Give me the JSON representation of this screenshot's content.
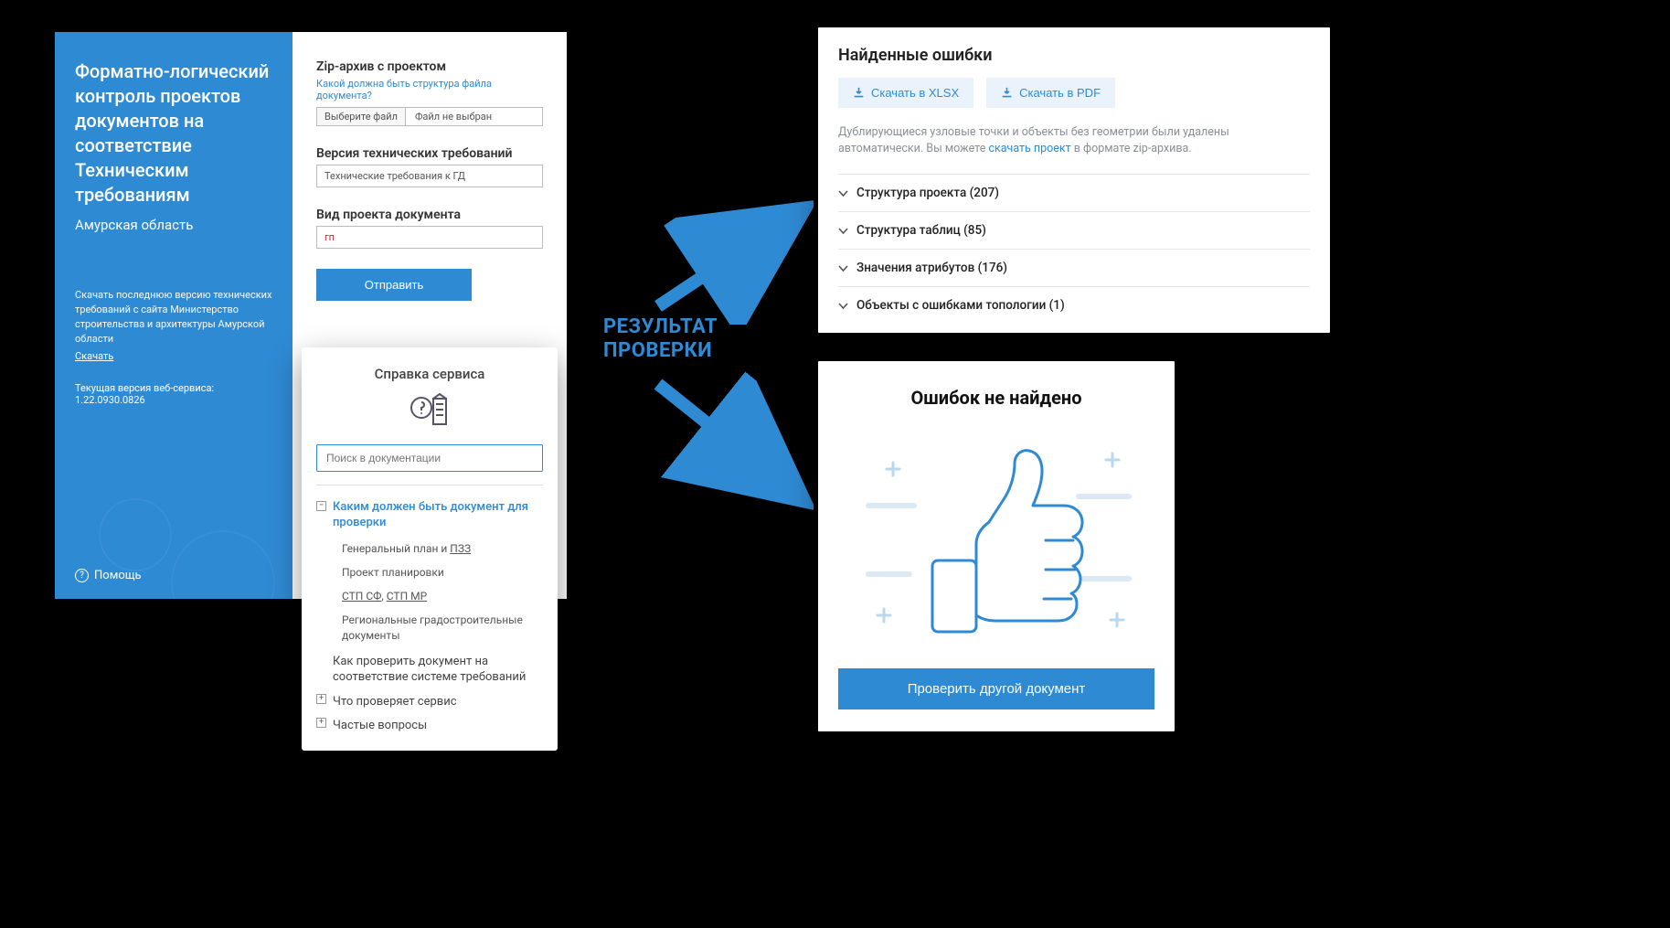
{
  "leftCard": {
    "title": "Форматно-логический контроль проектов документов на соответствие Техническим требованиям",
    "subtitle": "Амурская область",
    "desc": "Скачать последнюю версию технических требований с сайта Министерство строительства и архитектуры Амурской области",
    "downloadLink": "Скачать",
    "versionLabel": "Текущая версия веб-сервиса:",
    "version": "1.22.0930.0826",
    "helpLabel": "Помощь"
  },
  "form": {
    "zipLabel": "Zip-архив с проектом",
    "zipHint": "Какой должна быть структура файла документа?",
    "chooseFile": "Выберите файл",
    "noFile": "Файл не выбран",
    "versionLabel": "Версия технических требований",
    "versionValue": "Технические требования к ГД",
    "typeLabel": "Вид проекта документа",
    "typeValue": "гп",
    "submit": "Отправить"
  },
  "helpPanel": {
    "title": "Справка сервиса",
    "searchPlaceholder": "Поиск в документации",
    "section1": "Каким должен быть документ для проверки",
    "items": [
      "Генеральный план и ПЗЗ",
      "Проект планировки",
      "СТП СФ, СТП МР",
      "Региональные градостроительные документы"
    ],
    "item_gp_pzz_a": "Генеральный план и ",
    "item_gp_pzz_b": "ПЗЗ",
    "item_pp": "Проект планировки",
    "item_stp_a": "СТП СФ",
    "item_stp_sep": ", ",
    "item_stp_b": "СТП МР",
    "item_reg": "Региональные градостроительные документы",
    "section2": "Как проверить документ на соответствие системе требований",
    "section3": "Что проверяет сервис",
    "section4": "Частые вопросы"
  },
  "centerLabel": "РЕЗУЛЬТАТ ПРОВЕРКИ",
  "errors": {
    "title": "Найденные ошибки",
    "btnXlsx": "Скачать в XLSX",
    "btnPdf": "Скачать в PDF",
    "note1": "Дублирующиеся узловые точки и объекты без геометрии были удалены автоматически. Вы можете ",
    "noteLink": "скачать проект",
    "note2": " в формате zip-архива.",
    "rows": [
      {
        "label": "Структура проекта",
        "count": 207
      },
      {
        "label": "Структура таблиц",
        "count": 85
      },
      {
        "label": "Значения атрибутов",
        "count": 176
      },
      {
        "label": "Объекты с ошибками топологии",
        "count": 1
      }
    ]
  },
  "success": {
    "title": "Ошибок не найдено",
    "button": "Проверить другой документ"
  }
}
